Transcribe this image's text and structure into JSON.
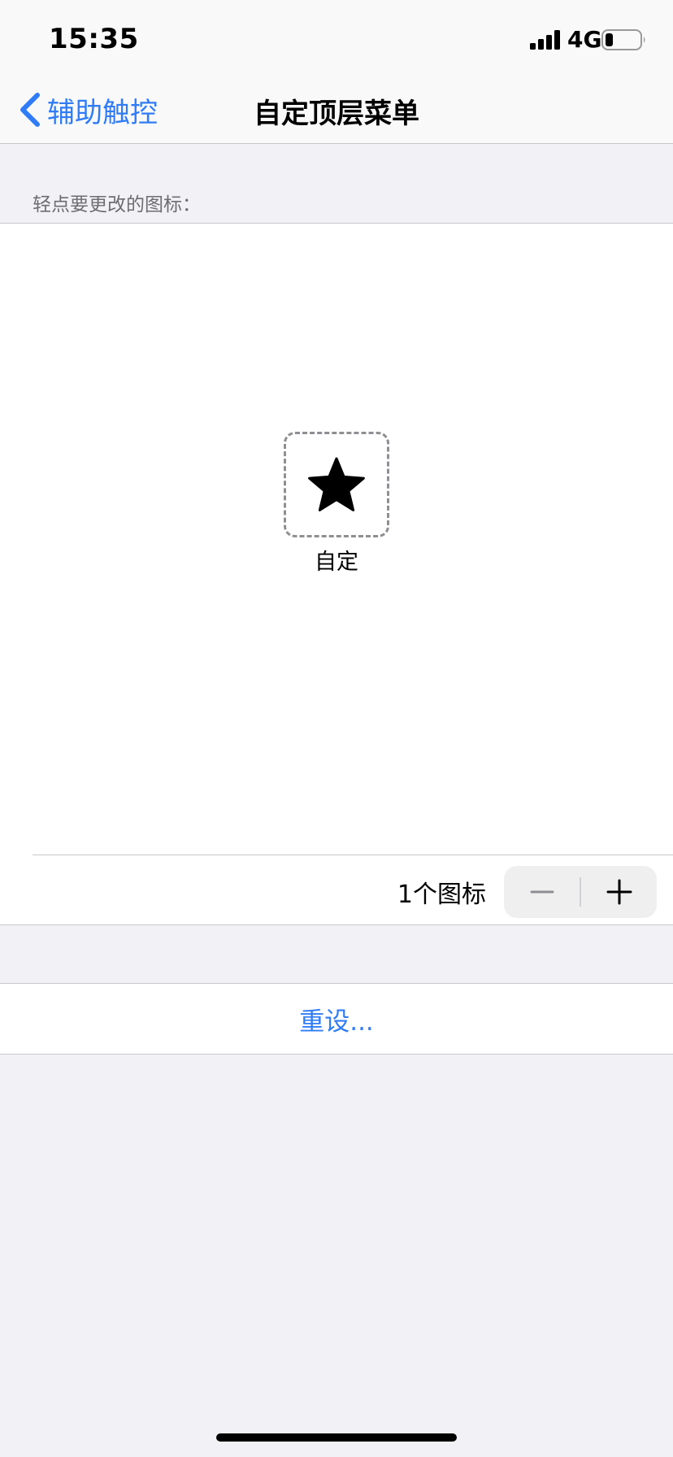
{
  "status_bar": {
    "time": "15:35",
    "network": "4G",
    "signal_icon": "cellular-signal-icon",
    "battery_icon": "battery-low-icon"
  },
  "nav": {
    "back_label": "辅助触控",
    "title": "自定顶层菜单"
  },
  "section_header": "轻点要更改的图标：",
  "editor": {
    "slot": {
      "icon": "star-icon",
      "label": "自定"
    },
    "icon_count": "1个图标",
    "stepper": {
      "minus_icon": "minus-icon",
      "plus_icon": "plus-icon"
    }
  },
  "reset": {
    "label": "重设..."
  },
  "colors": {
    "accent": "#2f7cf6",
    "background": "#f1f1f6",
    "panel": "#ffffff",
    "separator": "#c8c7cc",
    "secondary_text": "#6d6d72"
  }
}
